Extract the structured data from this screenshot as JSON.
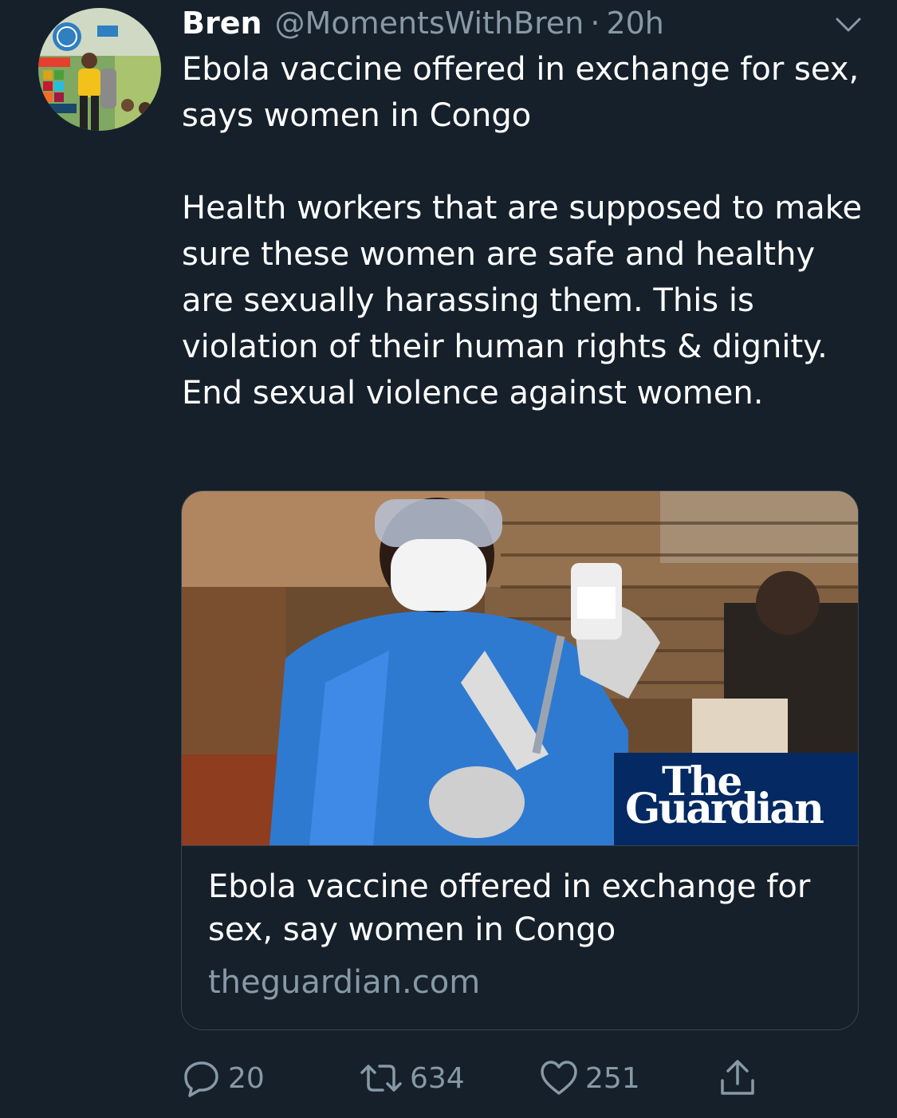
{
  "tweet": {
    "author": {
      "display_name": "Bren",
      "handle": "@MomentsWithBren",
      "separator": "·",
      "time": "20h"
    },
    "text": [
      "Ebola vaccine offered in exchange for sex, says women in Congo",
      "Health workers that are supposed to make sure these women are safe and healthy are sexually harassing them. This is violation of their human rights & dignity. End sexual violence against women."
    ],
    "card": {
      "logo_line1": "The",
      "logo_line2": "Guardian",
      "title": "Ebola vaccine offered in exchange for sex, say women in Congo",
      "domain": "theguardian.com"
    },
    "actions": {
      "replies": "20",
      "retweets": "634",
      "likes": "251"
    }
  },
  "colors": {
    "background": "#15202b",
    "text": "#ffffff",
    "secondary_text": "#8899a6",
    "border": "#38444d",
    "guardian_blue": "#052962"
  },
  "icons": {
    "caret": "chevron-down-icon",
    "reply": "reply-icon",
    "retweet": "retweet-icon",
    "like": "heart-icon",
    "share": "share-icon"
  }
}
